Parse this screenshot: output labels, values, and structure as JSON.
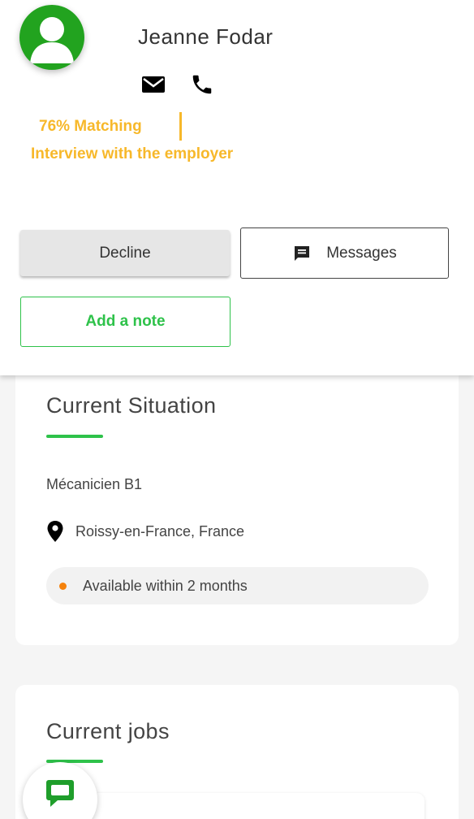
{
  "profile": {
    "name": "Jeanne Fodar",
    "avatar_color": "#22a31f",
    "icons": [
      "person-icon",
      "mail-icon",
      "phone-icon"
    ]
  },
  "status": {
    "matching": "76% Matching",
    "stage": "Interview with the employer",
    "accent_color": "#f7b82a"
  },
  "actions": {
    "decline": "Decline",
    "messages": "Messages",
    "add_note": "Add a note",
    "primary_color": "#2ec24a"
  },
  "situation": {
    "title": "Current Situation",
    "job_title": "Mécanicien B1",
    "location": "Roissy-en-France, France",
    "availability": "Available within 2 months",
    "availability_color": "#f5820c"
  },
  "jobs": {
    "title": "Current jobs"
  },
  "chat": {
    "icon": "chat-bubble-icon"
  }
}
